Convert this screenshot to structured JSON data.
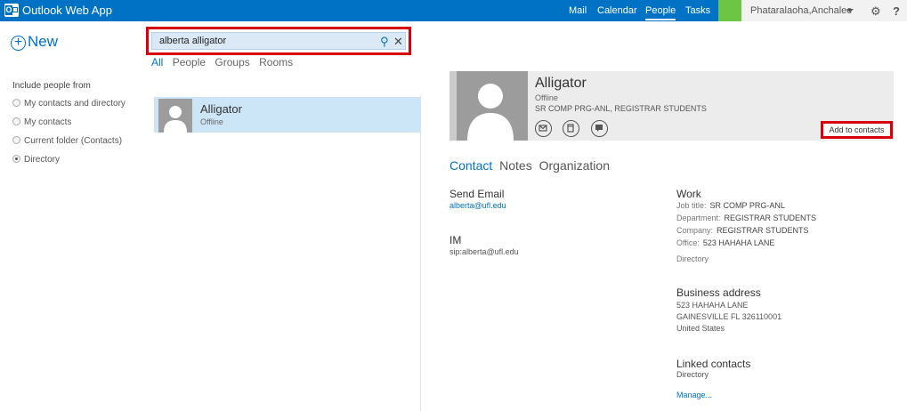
{
  "app": {
    "title": "Outlook Web App",
    "logo_letter": "O"
  },
  "nav": {
    "mail": "Mail",
    "calendar": "Calendar",
    "people": "People",
    "tasks": "Tasks"
  },
  "user": {
    "name": "Phataralaoha,Anchalee"
  },
  "toolbar": {
    "new_label": "New"
  },
  "include": {
    "title": "Include people from",
    "options": [
      {
        "label": "My contacts and directory",
        "selected": false
      },
      {
        "label": "My contacts",
        "selected": false
      },
      {
        "label": "Current folder (Contacts)",
        "selected": false
      },
      {
        "label": "Directory",
        "selected": true
      }
    ]
  },
  "search": {
    "value": "alberta alligator"
  },
  "filters": [
    "All",
    "People",
    "Groups",
    "Rooms"
  ],
  "results": [
    {
      "name": "Alligator",
      "status": "Offline"
    }
  ],
  "card": {
    "name": "Alligator",
    "status": "Offline",
    "departments": "SR COMP PRG-ANL, REGISTRAR STUDENTS",
    "add_contacts_label": "Add to contacts",
    "tabs": [
      "Contact",
      "Notes",
      "Organization"
    ],
    "send_email": {
      "title": "Send Email",
      "value": "alberta@ufl.edu"
    },
    "im": {
      "title": "IM",
      "value": "sip:alberta@ufl.edu"
    },
    "work": {
      "title": "Work",
      "job_title_label": "Job title:",
      "job_title": "SR COMP PRG-ANL",
      "department_label": "Department:",
      "department": "REGISTRAR STUDENTS",
      "company_label": "Company:",
      "company": "REGISTRAR STUDENTS",
      "office_label": "Office:",
      "office": "523 HAHAHA LANE",
      "source": "Directory"
    },
    "business_address": {
      "title": "Business address",
      "line1": "523 HAHAHA LANE",
      "line2": "GAINESVILLE FL 326110001",
      "line3": "United States"
    },
    "linked_contacts": {
      "title": "Linked contacts",
      "source": "Directory",
      "manage_label": "Manage..."
    }
  },
  "colors": {
    "brand": "#0072c6",
    "highlight": "#d9000d",
    "selection": "#cde6f7"
  }
}
